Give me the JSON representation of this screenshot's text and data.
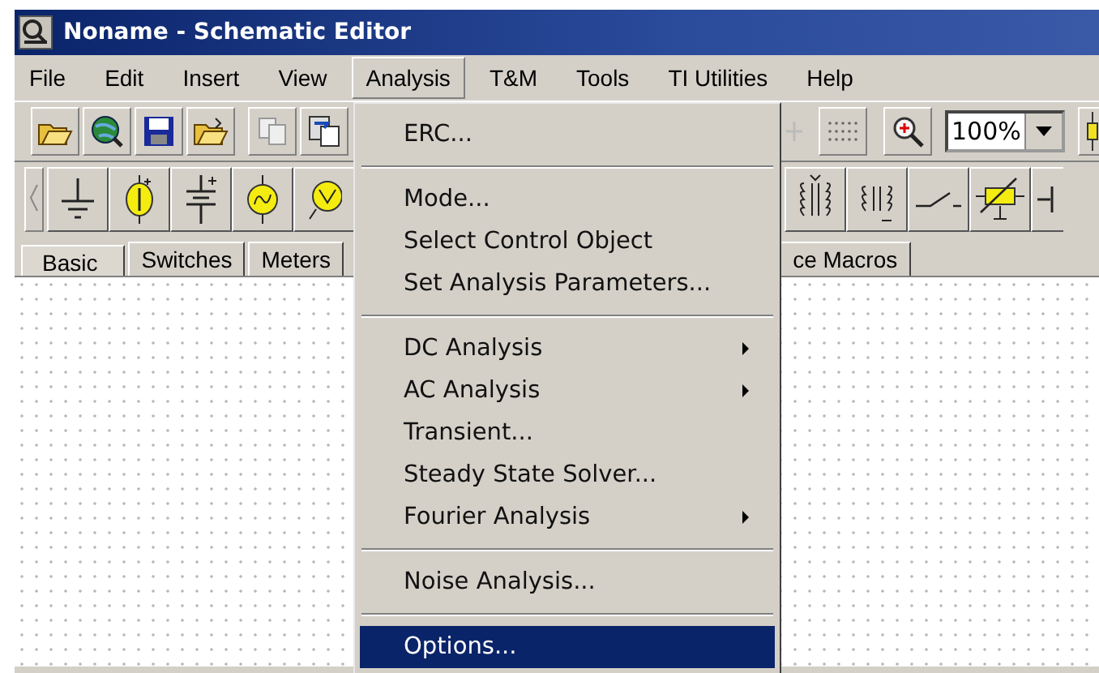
{
  "window": {
    "title": "Noname - Schematic Editor"
  },
  "menu_bar": [
    {
      "label": "File",
      "selected": false
    },
    {
      "label": "Edit",
      "selected": false
    },
    {
      "label": "Insert",
      "selected": false
    },
    {
      "label": "View",
      "selected": false
    },
    {
      "label": "Analysis",
      "selected": true
    },
    {
      "label": "T&M",
      "selected": false
    },
    {
      "label": "Tools",
      "selected": false
    },
    {
      "label": "TI Utilities",
      "selected": false
    },
    {
      "label": "Help",
      "selected": false
    }
  ],
  "toolbar": {
    "zoom": {
      "value": "100%"
    }
  },
  "component_tabs": [
    {
      "label": "Basic",
      "selected": true
    },
    {
      "label": "Switches",
      "selected": false
    },
    {
      "label": "Meters",
      "selected": false
    },
    {
      "label": "ce Macros",
      "selected": false
    }
  ],
  "analysis_menu": [
    {
      "kind": "item",
      "label": "ERC...",
      "submenu": false,
      "selected": false
    },
    {
      "kind": "separator"
    },
    {
      "kind": "item",
      "label": "Mode...",
      "submenu": false,
      "selected": false
    },
    {
      "kind": "item",
      "label": "Select Control Object",
      "submenu": false,
      "selected": false
    },
    {
      "kind": "item",
      "label": "Set Analysis Parameters...",
      "submenu": false,
      "selected": false
    },
    {
      "kind": "separator"
    },
    {
      "kind": "item",
      "label": "DC Analysis",
      "submenu": true,
      "selected": false
    },
    {
      "kind": "item",
      "label": "AC Analysis",
      "submenu": true,
      "selected": false
    },
    {
      "kind": "item",
      "label": "Transient...",
      "submenu": false,
      "selected": false
    },
    {
      "kind": "item",
      "label": "Steady State Solver...",
      "submenu": false,
      "selected": false
    },
    {
      "kind": "item",
      "label": "Fourier Analysis",
      "submenu": true,
      "selected": false
    },
    {
      "kind": "separator"
    },
    {
      "kind": "item",
      "label": "Noise Analysis...",
      "submenu": false,
      "selected": false
    },
    {
      "kind": "separator"
    },
    {
      "kind": "item",
      "label": "Options...",
      "submenu": false,
      "selected": true
    }
  ]
}
